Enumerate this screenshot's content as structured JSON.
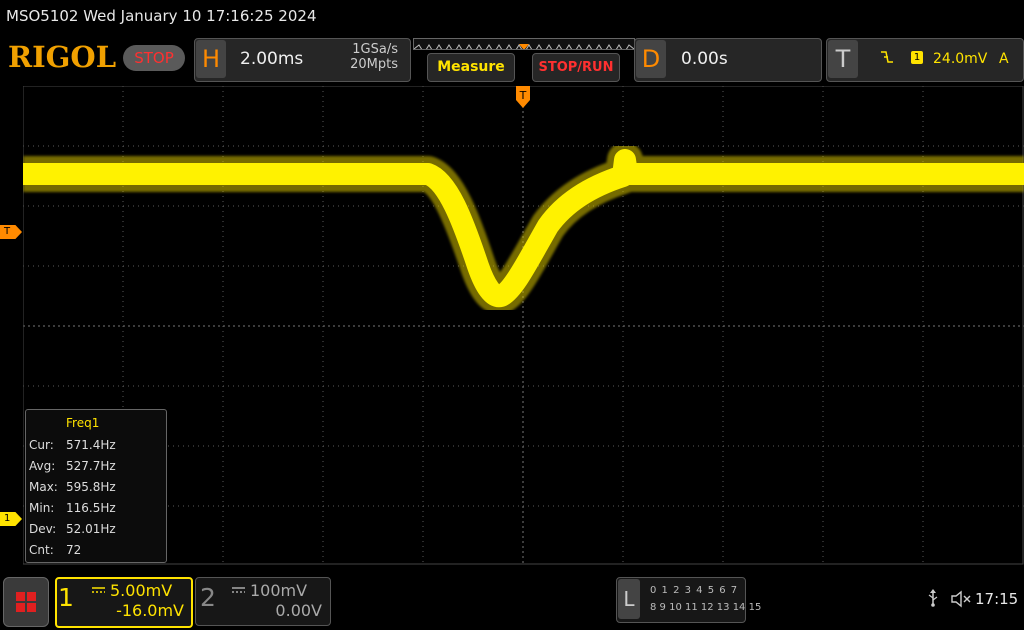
{
  "header": {
    "device_line": "MSO5102  Wed January 10 17:16:25 2024",
    "logo": "RIGOL",
    "run_state": "STOP"
  },
  "horizontal": {
    "letter": "H",
    "timebase": "2.00ms",
    "sample_rate": "1GSa/s",
    "memory_depth": "20Mpts"
  },
  "buttons": {
    "measure": "Measure",
    "stop_run": "STOP/RUN"
  },
  "delay": {
    "letter": "D",
    "value": "0.00s"
  },
  "trigger": {
    "letter": "T",
    "source": "1",
    "level": "24.0mV",
    "mode": "A",
    "marker": "T"
  },
  "measurement": {
    "title": "Freq1",
    "rows": [
      {
        "label": "Cur:",
        "value": "571.4Hz"
      },
      {
        "label": "Avg:",
        "value": "527.7Hz"
      },
      {
        "label": "Max:",
        "value": "595.8Hz"
      },
      {
        "label": "Min:",
        "value": "116.5Hz"
      },
      {
        "label": "Dev:",
        "value": "52.01Hz"
      },
      {
        "label": "Cnt:",
        "value": "72"
      }
    ]
  },
  "channels": {
    "ch1": {
      "num": "1",
      "scale": "5.00mV",
      "offset": "-16.0mV",
      "marker": "1",
      "color": "#ffe300"
    },
    "ch2": {
      "num": "2",
      "scale": "100mV",
      "offset": "0.00V",
      "color": "#888888"
    }
  },
  "logic": {
    "letter": "L",
    "row1": "0 1 2 3  4 5 6 7",
    "row2": "8  9 10 11  12 13 14 15"
  },
  "status": {
    "clock": "17:15"
  }
}
